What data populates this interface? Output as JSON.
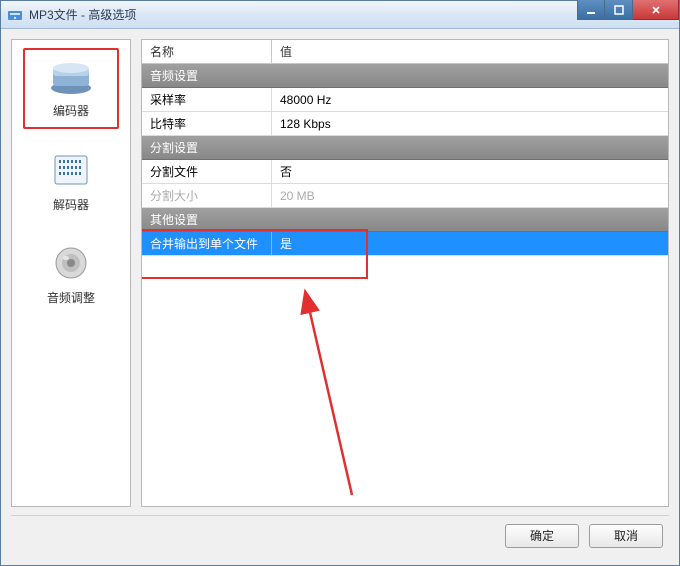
{
  "window": {
    "title": "MP3文件 - 高级选项"
  },
  "sidebar": {
    "items": [
      {
        "label": "编码器",
        "icon": "encoder",
        "selected": true
      },
      {
        "label": "解码器",
        "icon": "decoder",
        "selected": false
      },
      {
        "label": "音频调整",
        "icon": "audio",
        "selected": false
      }
    ]
  },
  "grid": {
    "columns": {
      "name": "名称",
      "value": "值"
    },
    "sections": [
      {
        "title": "音频设置",
        "rows": [
          {
            "name": "采样率",
            "value": "48000 Hz"
          },
          {
            "name": "比特率",
            "value": "128 Kbps"
          }
        ]
      },
      {
        "title": "分割设置",
        "rows": [
          {
            "name": "分割文件",
            "value": "否"
          },
          {
            "name": "分割大小",
            "value": "20 MB",
            "disabled": true
          }
        ]
      },
      {
        "title": "其他设置",
        "rows": [
          {
            "name": "合并输出到单个文件",
            "value": "是",
            "selected": true
          }
        ]
      }
    ]
  },
  "buttons": {
    "ok": "确定",
    "cancel": "取消"
  },
  "annotation": {
    "highlight_color": "#e03030",
    "arrow_color": "#e03030"
  }
}
